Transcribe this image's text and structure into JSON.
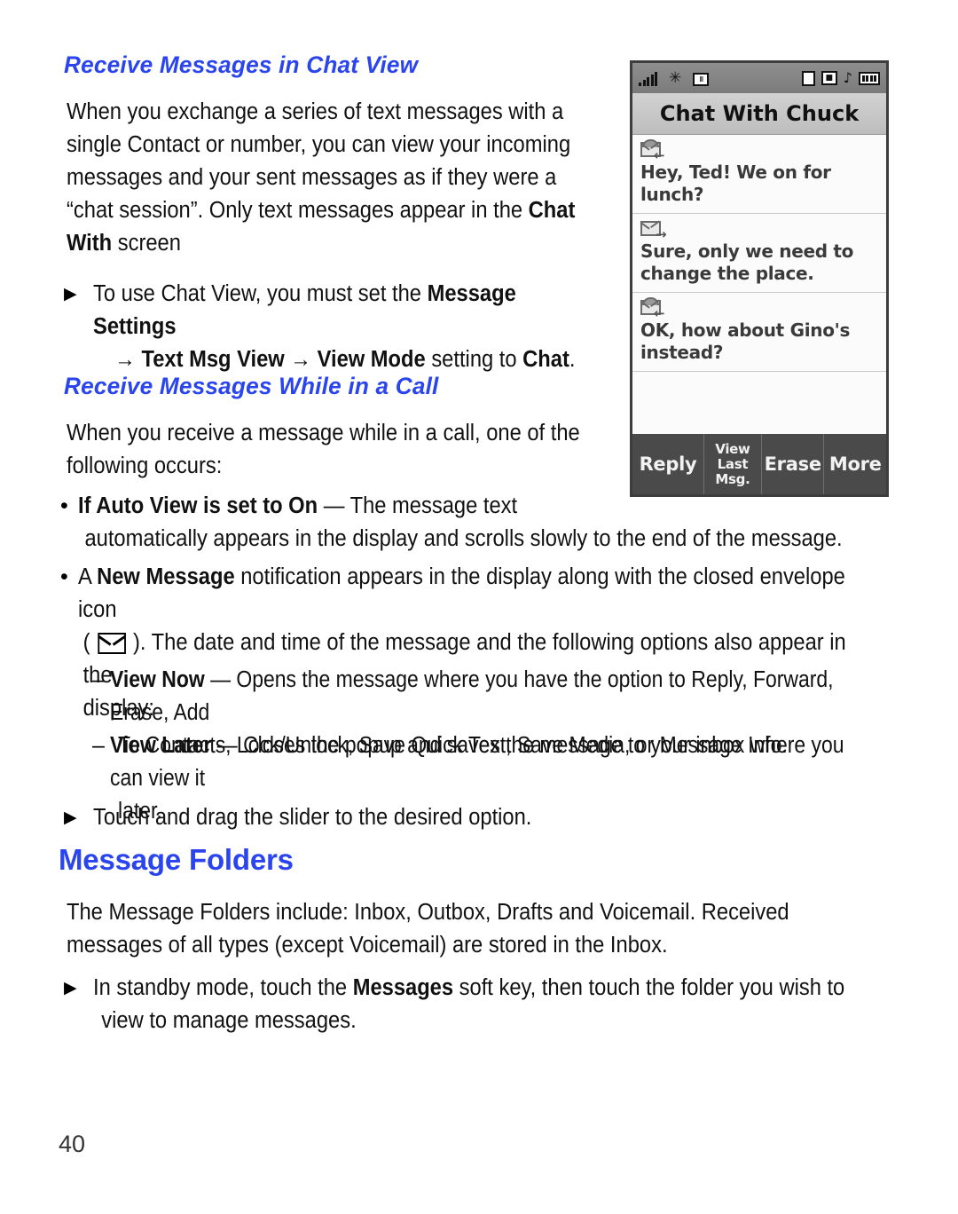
{
  "page": {
    "number": "40",
    "accent_color": "#2a44ee",
    "text_color": "#111111"
  },
  "sections": [
    {
      "heading": "Receive Messages in Chat View",
      "paragraph_lines": [
        "When you exchange a series of text messages with a",
        "single Contact or number, you can view your incoming",
        "messages and your sent messages as if they were a"
      ],
      "paragraph_line4_a": "“chat session”. Only text messages appear in the ",
      "paragraph_line4_b": "Chat",
      "paragraph_line5_a": "With",
      "paragraph_line5_b": " screen",
      "bullet_marker": "▶",
      "bullet_line1_a": "To use Chat View, you must set the ",
      "bullet_line1_b": "Message Settings",
      "bullet_line2_arrow1": "→",
      "bullet_line2_a": " Text Msg View ",
      "bullet_line2_arrow2": "→",
      "bullet_line2_b": " View Mode",
      "bullet_line2_c": " setting to ",
      "bullet_line2_d": "Chat",
      "bullet_line2_e": "."
    },
    {
      "heading": "Receive Messages While in a Call",
      "paragraph_lines": [
        "When you receive a message while in a call, one of the",
        "following occurs:"
      ]
    }
  ],
  "call_bullets": {
    "dot_marker": "•",
    "dash_marker": "–",
    "b1_bold": "If Auto View is set to On",
    "b1_rest": " — The message text",
    "b1_line2": "automatically appears in the display and scrolls slowly to the end of the message.",
    "b2_pre": "A ",
    "b2_bold": "New Message",
    "b2_rest": " notification appears in the display along with the closed envelope icon",
    "b2_line2_pre": "( ",
    "b2_line2_post": " ). The date and time of the message and the following options also appear in the",
    "b2_line3": "display:",
    "sub1_bold": "View Now",
    "sub1_rest": " — Opens the message where you have the option to Reply, Forward, Erase, Add",
    "sub1_line2": "To Contacts, Lock/Unlock, Save Quick Text, Save Media, or Message Info.",
    "sub2_bold": "View Later",
    "sub2_rest": " — Closes the popup and saves the message to your inbox where you can view it",
    "sub2_line2": "later.",
    "slider_marker": "▶",
    "slider_text": "Touch and drag the slider to the desired option."
  },
  "message_folders": {
    "heading": "Message Folders",
    "paragraph_line1": "The Message Folders include: Inbox, Outbox, Drafts and Voicemail. Received",
    "paragraph_line2": "messages of all types (except Voicemail) are stored in the Inbox.",
    "bullet_marker": "▶",
    "bullet_pre": "In standby mode, touch the ",
    "bullet_bold": "Messages",
    "bullet_post": " soft key, then touch the folder you wish to",
    "bullet_line2": "view to manage messages."
  },
  "phone": {
    "status_bar": {
      "signal_icon": "signal-bars-icon",
      "bluetooth_icon": "bluetooth-star-icon",
      "tty_icon": "tty-box-icon",
      "display_icon": "display-rect-icon",
      "alert_icon": "alert-box-icon",
      "music_icon": "♪",
      "battery_icon": "battery-icon"
    },
    "title": "Chat With Chuck",
    "messages": [
      {
        "direction": "inbound",
        "icon": "incoming-envelope-icon",
        "arrow": "←",
        "text": "Hey, Ted!  We on for lunch?"
      },
      {
        "direction": "outbound",
        "icon": "outgoing-envelope-icon",
        "arrow": "→",
        "text": "Sure, only we need to change the place."
      },
      {
        "direction": "inbound",
        "icon": "incoming-envelope-icon",
        "arrow": "←",
        "text": "OK, how about Gino's instead?"
      }
    ],
    "soft_keys": [
      {
        "label": "Reply",
        "multiline": false
      },
      {
        "label": "View Last Msg.",
        "multiline": true
      },
      {
        "label": "Erase",
        "multiline": false
      },
      {
        "label": "More",
        "multiline": false
      }
    ]
  }
}
